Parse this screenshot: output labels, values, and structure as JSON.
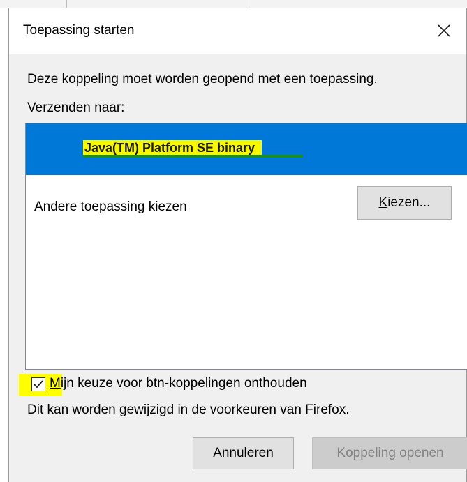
{
  "dialog": {
    "title": "Toepassing starten",
    "prompt": "Deze koppeling moet worden geopend met een toepassing.",
    "send_to_label": "Verzenden naar:",
    "apps": [
      {
        "label": "Java(TM) Platform SE binary",
        "selected": true
      }
    ],
    "other_app_label": "Andere toepassing kiezen",
    "choose_button": {
      "accesskey": "K",
      "rest": "iezen..."
    },
    "remember": {
      "checked": true,
      "accesskey": "M",
      "rest": "ijn keuze voor btn-koppelingen onthouden"
    },
    "info": "Dit kan worden gewijzigd in de voorkeuren van Firefox.",
    "cancel_label": "Annuleren",
    "open_label": "Koppeling openen"
  },
  "colors": {
    "selection": "#0078d7",
    "highlight": "#ffff00",
    "dialog_bg": "#f0f0f0"
  },
  "icons": [
    "close-icon",
    "checkmark-icon"
  ]
}
